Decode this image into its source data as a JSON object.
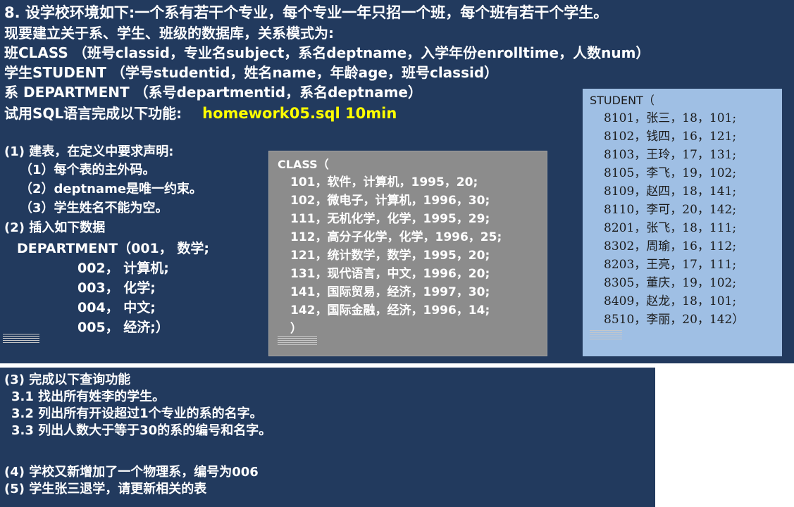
{
  "intro": {
    "title_line": "8. 设学校环境如下:一个系有若干个专业，每个专业一年只招一个班，每个班有若干个学生。",
    "line2": "现要建立关于系、学生、班级的数据库，关系模式为:",
    "schema_class": "班CLASS （班号classid，专业名subject，系名deptname，入学年份enrolltime，人数num）",
    "schema_student": "学生STUDENT （学号studentid，姓名name，年龄age，班号classid）",
    "schema_department": "系 DEPARTMENT （系号departmentid，系名deptname）",
    "task_prefix": "试用SQL语言完成以下功能:",
    "task_file": "homework05.sql 10min"
  },
  "part1": {
    "heading": "(1) 建表，在定义中要求声明:",
    "items": [
      "（1）每个表的主外码。",
      "（2）deptname是唯一约束。",
      "（3）学生姓名不能为空。"
    ]
  },
  "part2": {
    "heading": "(2) 插入如下数据",
    "dept_lines": [
      "DEPARTMENT（001，  数学;",
      "002，  计算机;",
      "003，  化学;",
      "004，  中文;",
      "005，  经济;）"
    ]
  },
  "class_panel": {
    "lines": [
      "CLASS（",
      "101，软件，计算机，1995，20;",
      "102，微电子，计算机，1996，30;",
      "111，无机化学，化学，1995，29;",
      "112，高分子化学，化学，1996，25;",
      "121，统计数学，数学，1995，20;",
      "131，现代语言，中文，1996，20;",
      "141，国际贸易，经济，1997，30;",
      "142，国际金融，经济，1996，14;",
      "）"
    ]
  },
  "student_panel": {
    "lines": [
      "STUDENT（",
      "8101，张三，18，101;",
      "8102，钱四，16，121;",
      "8103，王玲，17，131;",
      "8105，李飞，19，102;",
      "8109，赵四，18，141;",
      "8110，李可，20，142;",
      "8201，张飞，18，111;",
      "8302，周瑜，16，112;",
      "8203，王亮，17，111;",
      "8305，董庆，19，102;",
      "8409，赵龙，18，101;",
      "8510，李丽，20，142）"
    ]
  },
  "part3": {
    "heading": "(3) 完成以下查询功能",
    "items": [
      "3.1 找出所有姓李的学生。",
      "3.2 列出所有开设超过1个专业的系的名字。",
      "3.3 列出人数大于等于30的系的编号和名字。"
    ]
  },
  "part4": "(4) 学校又新增加了一个物理系，编号为006",
  "part5": "(5) 学生张三退学，请更新相关的表",
  "colors": {
    "slide_bg": "#223a5e",
    "text": "#ffffff",
    "highlight": "#ffff00",
    "class_panel_bg": "#8c8c8c",
    "student_panel_bg": "#9fbfe4"
  }
}
